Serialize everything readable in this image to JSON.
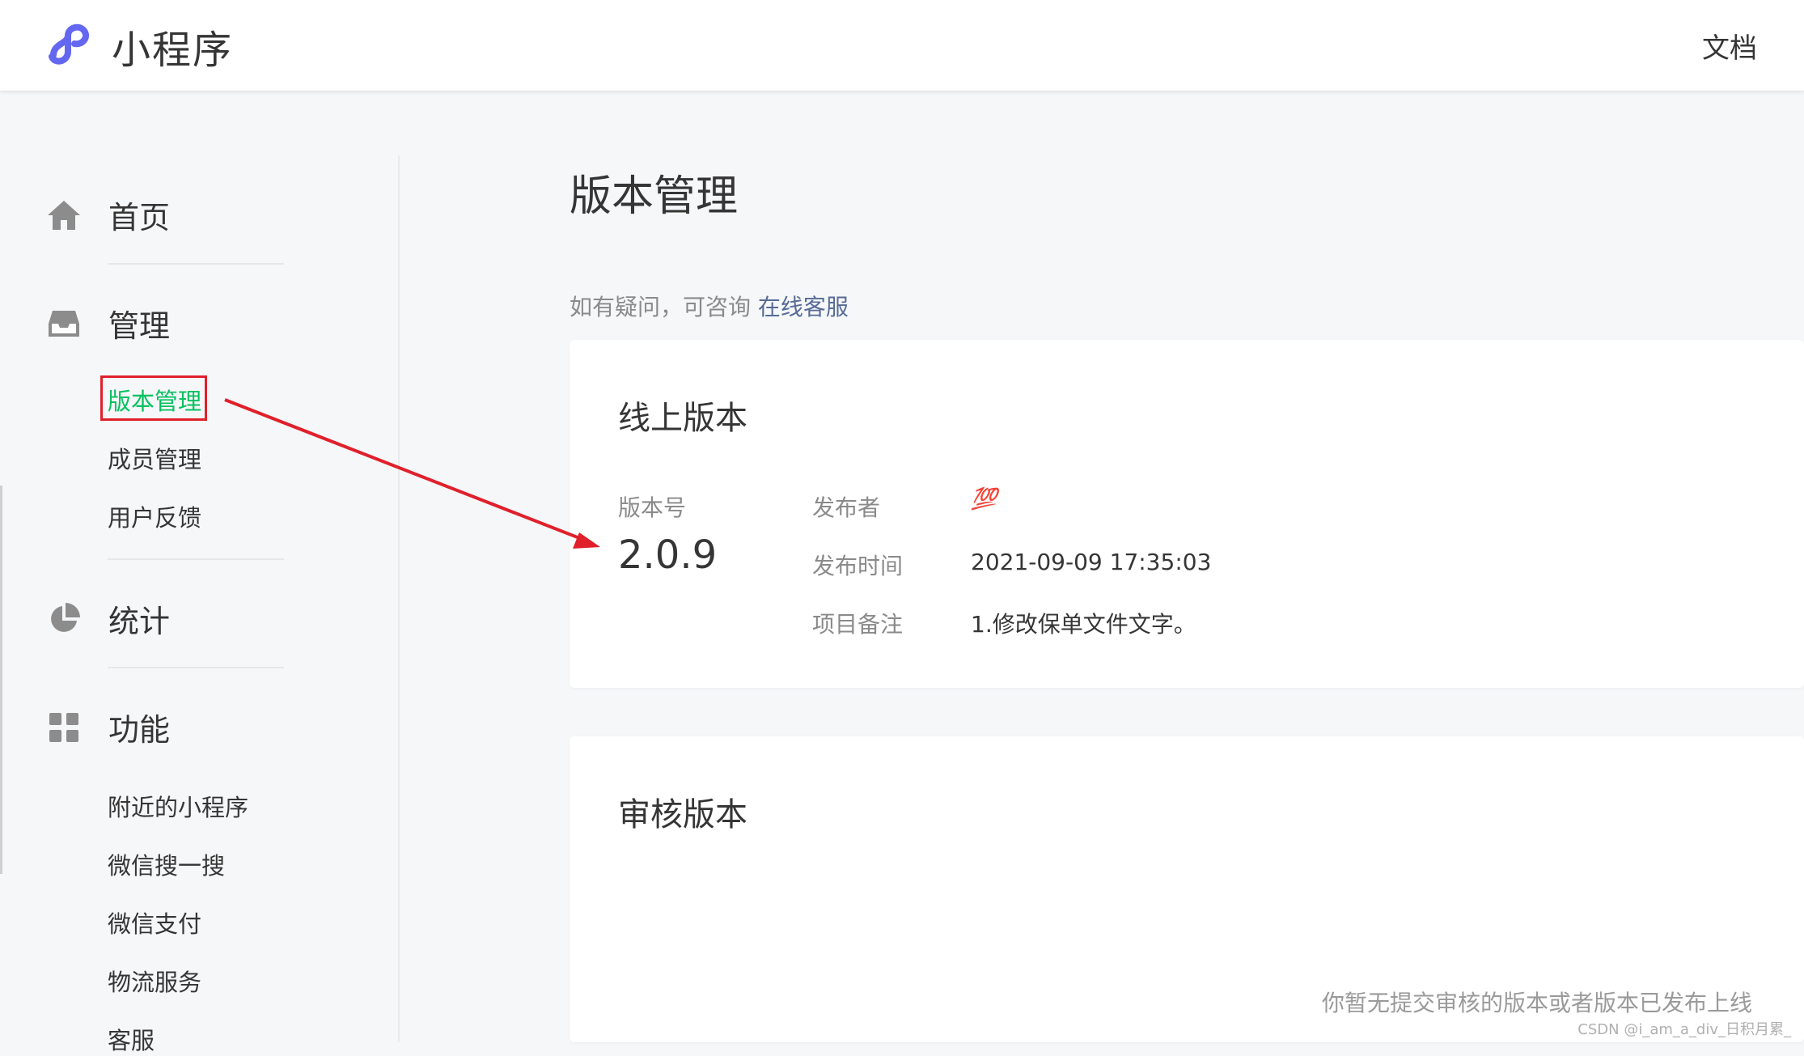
{
  "header": {
    "brand": "小程序",
    "docs_label": "文档"
  },
  "sidebar": {
    "groups": [
      {
        "label": "首页",
        "icon": "home-icon"
      },
      {
        "label": "管理",
        "icon": "inbox-icon"
      },
      {
        "label": "统计",
        "icon": "pie-chart-icon"
      },
      {
        "label": "功能",
        "icon": "grid-icon"
      }
    ],
    "manage_items": [
      "版本管理",
      "成员管理",
      "用户反馈"
    ],
    "feature_items": [
      "附近的小程序",
      "微信搜一搜",
      "微信支付",
      "物流服务",
      "客服"
    ]
  },
  "main": {
    "title": "版本管理",
    "help_prefix": "如有疑问，可咨询",
    "help_link": "在线客服",
    "online": {
      "title": "线上版本",
      "version_label": "版本号",
      "version": "2.0.9",
      "publisher_label": "发布者",
      "publisher_value": "💯",
      "time_label": "发布时间",
      "time_value": "2021-09-09 17:35:03",
      "note_label": "项目备注",
      "note_value": "1.修改保单文件文字。"
    },
    "review": {
      "title": "审核版本",
      "empty": "你暂无提交审核的版本或者版本已发布上线"
    }
  },
  "watermark": "CSDN @i_am_a_div_日积月累_",
  "colors": {
    "accent_green": "#07c160",
    "link": "#576b95",
    "annotation_red": "#e0202b",
    "logo": "#6467f0"
  }
}
